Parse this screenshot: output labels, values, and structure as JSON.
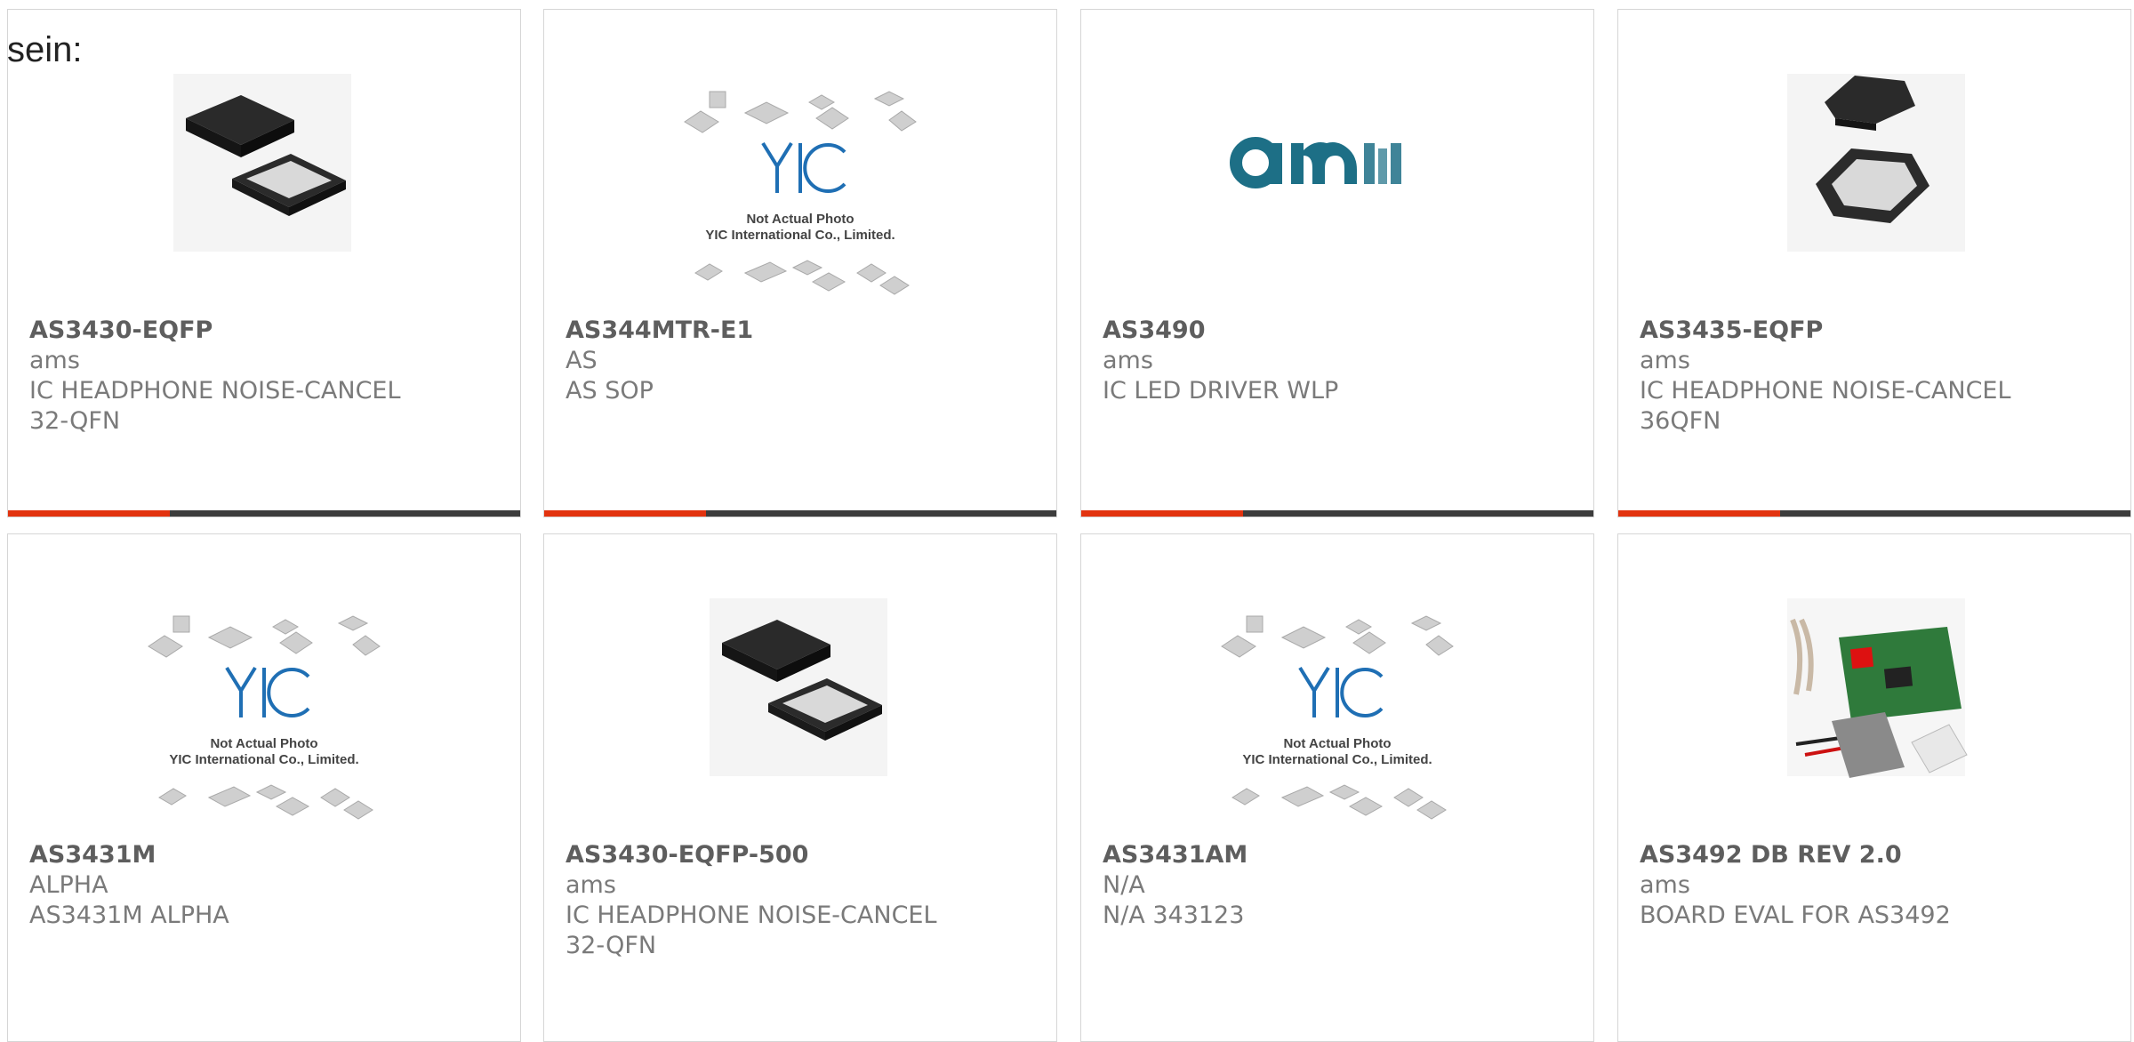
{
  "page": {
    "intro_text": "sein:"
  },
  "colors": {
    "accent": "#e2330f",
    "bar": "#3c3c3c",
    "title_text": "#5e5e5e",
    "body_text": "#7a7a7a",
    "ams_logo": "#1d6f86",
    "yic_logo": "#1f6fb4"
  },
  "products": [
    {
      "part": "AS3430-EQFP",
      "manufacturer": "ams",
      "desc1": "IC HEADPHONE NOISE-CANCEL",
      "desc2": "32-QFN",
      "image": "qfn-chip-pair"
    },
    {
      "part": "AS344MTR-E1",
      "manufacturer": "AS",
      "desc1": "AS SOP",
      "desc2": "",
      "image": "yic-placeholder",
      "image_text1": "Not Actual Photo",
      "image_text2": "YIC International Co., Limited."
    },
    {
      "part": "AS3490",
      "manufacturer": "ams",
      "desc1": "IC LED DRIVER WLP",
      "desc2": "",
      "image": "ams-logo"
    },
    {
      "part": "AS3435-EQFP",
      "manufacturer": "ams",
      "desc1": "IC HEADPHONE NOISE-CANCEL",
      "desc2": "36QFN",
      "image": "qfn-chip-stack"
    },
    {
      "part": "AS3431M",
      "manufacturer": "ALPHA",
      "desc1": "AS3431M ALPHA",
      "desc2": "",
      "image": "yic-placeholder",
      "image_text1": "Not Actual Photo",
      "image_text2": "YIC International Co., Limited."
    },
    {
      "part": "AS3430-EQFP-500",
      "manufacturer": "ams",
      "desc1": "IC HEADPHONE NOISE-CANCEL",
      "desc2": "32-QFN",
      "image": "qfn-chip-pair"
    },
    {
      "part": "AS3431AM",
      "manufacturer": "N/A",
      "desc1": "N/A 343123",
      "desc2": "",
      "image": "yic-placeholder",
      "image_text1": "Not Actual Photo",
      "image_text2": "YIC International Co., Limited."
    },
    {
      "part": "AS3492 DB REV 2.0",
      "manufacturer": "ams",
      "desc1": "BOARD EVAL FOR AS3492",
      "desc2": "",
      "image": "eval-board"
    }
  ]
}
